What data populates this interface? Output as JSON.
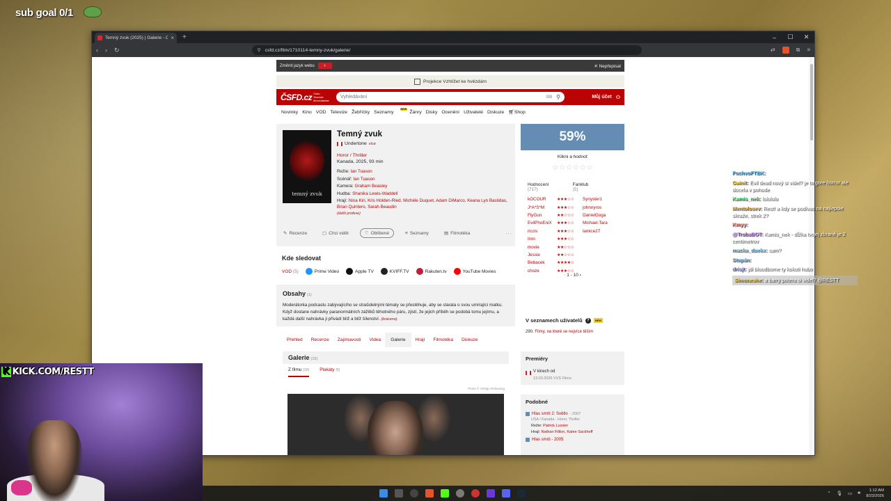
{
  "overlay": {
    "sub_goal": "sub goal 0/1",
    "kick_handle": "KICK.COM/RESTT",
    "kick_k": "K"
  },
  "browser": {
    "tab_title": "Temný zvuk (2025) | Galerie - Č",
    "url": "csfd.cz/film/1710114-temny-zvuk/galerie/",
    "window_controls": [
      "–",
      "☐",
      "✕"
    ]
  },
  "langbar": {
    "text": "Změnit jazyk webu",
    "close": "✕ Nepřepisat"
  },
  "promo": {
    "text": "Projekce Vzhlížet ke hvězdám"
  },
  "header": {
    "logo": "ČSFD.cz",
    "logo_sub": "Česko-Slovenská filmová databáze",
    "search_placeholder": "Vyhledávání",
    "account": "Můj účet"
  },
  "nav": [
    "Novinky",
    "Kino",
    "VOD",
    "Televize",
    "Žebříčky",
    "Seznamy",
    "Žánry",
    "Disky",
    "Ocenění",
    "Uživatelé",
    "Diskuze",
    "Shop"
  ],
  "nav_new_badge": "NEW",
  "film": {
    "title": "Temný zvuk",
    "original_title": "Undertone",
    "original_more": "více",
    "poster_title": "temný zvuk",
    "genres": "Horor / Thriller",
    "origin": "Kanada",
    "year": "2025",
    "length": "93 min",
    "directing_label": "Režie:",
    "directing": "Ian Tuason",
    "script_label": "Scénář:",
    "script": "Ian Tuason",
    "camera_label": "Kamera:",
    "camera": "Graham Beasley",
    "music_label": "Hudba:",
    "music": "Shanika Lewis-Waddell",
    "cast_label": "Hrají:",
    "cast": "Nina Kiri, Kris Holden-Ried, Michèle Duquet, Adam DiMarco, Keana Lyn Bastidas, Brian Quintero, Sarah Beaudin",
    "more_creators": "(další profese)"
  },
  "actions": [
    {
      "icon": "✎",
      "label": "Recenze"
    },
    {
      "icon": "▢",
      "label": "Chci vidět"
    },
    {
      "icon": "♡",
      "label": "Oblíbené"
    },
    {
      "icon": "≡",
      "label": "Seznamy"
    },
    {
      "icon": "▤",
      "label": "Filmotéka"
    }
  ],
  "actions_more": "···",
  "rating": {
    "percent": "59%",
    "rate_label": "Klikni a hodnoť",
    "empty_stars": "☆☆☆☆☆☆",
    "hodnoceni_label": "Hodnocení",
    "hodnoceni_count": "(717)",
    "fanklub_label": "Fanklub",
    "fanklub_count": "(5)",
    "users": [
      {
        "name": "kOCOUR",
        "stars": "★★★☆☆",
        "fan": "Synyster1"
      },
      {
        "name": "J*A*S*M",
        "stars": "★★★☆☆",
        "fan": "johnnyros"
      },
      {
        "name": "FlyGun",
        "stars": "★★☆☆☆",
        "fan": "DanielGoga"
      },
      {
        "name": "EvilPhoEniX",
        "stars": "★★★☆☆",
        "fan": "Michael.Tara"
      },
      {
        "name": "riccis",
        "stars": "★★★☆☆",
        "fan": "lamice27"
      },
      {
        "name": "Iron",
        "stars": "★★★☆☆",
        "fan": ""
      },
      {
        "name": "movie",
        "stars": "★★☆☆☆",
        "fan": ""
      },
      {
        "name": "Jessie",
        "stars": "★★☆☆☆",
        "fan": ""
      },
      {
        "name": "Bebacek",
        "stars": "★★★★☆",
        "fan": ""
      },
      {
        "name": "choze",
        "stars": "★★★☆☆",
        "fan": ""
      }
    ],
    "pager_text": "1 - 10",
    "pager_next": "›"
  },
  "watch": {
    "title": "Kde sledovat",
    "vod_label": "VOD",
    "vod_count": "(5)",
    "services": [
      {
        "name": "Prime Video",
        "color": "#1a98ff"
      },
      {
        "name": "Apple TV",
        "color": "#111111"
      },
      {
        "name": "KVIFF.TV",
        "color": "#222222"
      },
      {
        "name": "Rakuten.tv",
        "color": "#bf1f3a"
      },
      {
        "name": "YouTube Movies",
        "color": "#ff0000"
      }
    ]
  },
  "plot": {
    "title": "Obsahy",
    "count": "(1)",
    "text": "Moderátorka podcastu zabývajícího se strašidelnými tématy se přestěhuje, aby se starala o svou umírající matku. Když dostane nahrávky paranormálních zážitků těhotného páru, zjistí, že jejich příběh se podobá tomu jejímu, a každá další nahrávka ji přivádí blíž a blíž šílenství.",
    "more": "(kráceno)"
  },
  "film_tabs": [
    "Přehled",
    "Recenze",
    "Zajímavosti",
    "Videa",
    "Galerie",
    "Hrají",
    "Filmotéka",
    "Diskuze"
  ],
  "gallery": {
    "title": "Galerie",
    "count": "(15)",
    "tab_films": "Z filmu",
    "tab_films_count": "(10)",
    "tab_posters": "Plakáty",
    "tab_posters_count": "(5)",
    "credit": "Photo © Vertigo Releasing"
  },
  "user_lists": {
    "title": "V seznamech uživatelů",
    "q": "?",
    "new": "NEW",
    "count": "290.",
    "text": "Filmy, na které se nejvíce těším"
  },
  "premieres": {
    "title": "Premiéry",
    "line": "V kinech od",
    "date": "13.03.2026 VVS Films"
  },
  "similar": {
    "title": "Podobné",
    "item_title": "Hlas smrti 2: Světlo",
    "item_year": "- 2007",
    "item_meta": "USA / Kanada - Horor, Thriller",
    "item_director_label": "Režie:",
    "item_director": "Patrick Lussier",
    "item_cast_label": "Hrají:",
    "item_cast": "Nathan Fillion, Katee Sackhoff",
    "next_item": "Hlas smrti - 2005"
  },
  "chat": [
    {
      "user": "FochvoFTBK:",
      "text": "",
      "color": "#7fd1ff"
    },
    {
      "user": "Gainit:",
      "text": "Evil dead nový si videl? je to gore horror ale docela v pohode",
      "color": "#ffdd55"
    },
    {
      "user": "Kamis_nek:",
      "text": "lolololo",
      "color": "#7fffa0"
    },
    {
      "user": "Mentolosev:",
      "text": "Rest! a kdy se podívas na najlepsie skraže, strek 2?",
      "color": "#ffcc66"
    },
    {
      "user": "Kmyy:",
      "text": "",
      "color": "#ff9a9a"
    },
    {
      "user": "@TrubaBOT:",
      "text": "Kamis_nek - dĺžka tvojej zbraně je 2 centimetrov",
      "color": "#cfa0ff"
    },
    {
      "user": "macka_duekx:",
      "text": "sam?",
      "color": "#a0e0ff"
    },
    {
      "user": "Stopán:",
      "text": "",
      "color": "#9ad0ff"
    },
    {
      "user": "drisjt:",
      "text": "jdi bloodborne ty kokoti hubo",
      "color": "#c0c0ff"
    },
    {
      "user": "Simoneshe:",
      "text": "a barry potera si videl? @RESTT",
      "color": "#ffe07a"
    }
  ],
  "taskbar": {
    "time": "1:12 AM",
    "date": "8/23/2026"
  }
}
